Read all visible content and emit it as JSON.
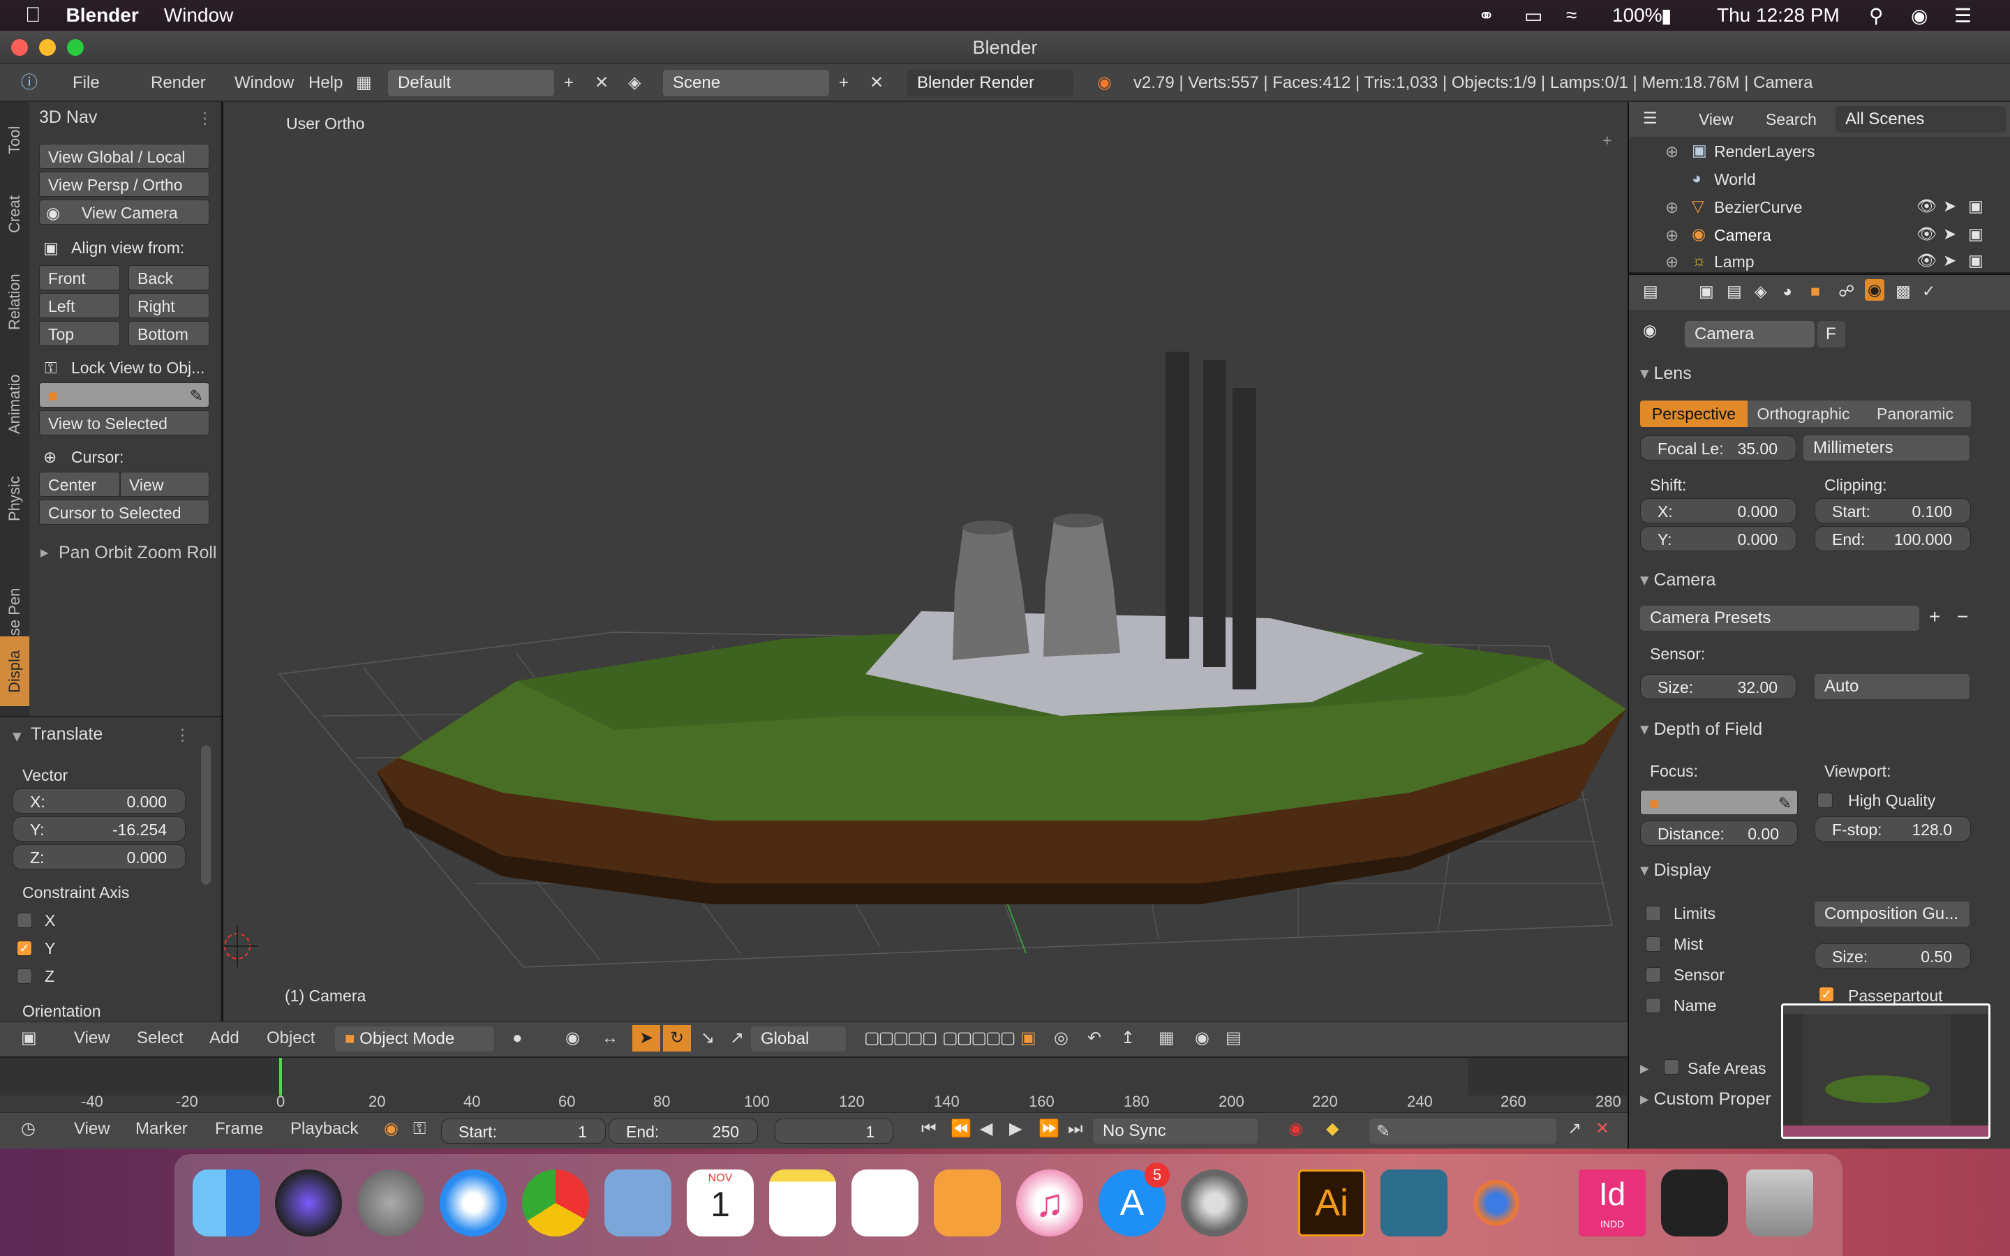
{
  "menubar": {
    "app": "Blender",
    "window_menu": "Window",
    "battery": "100%",
    "clock": "Thu 12:28 PM"
  },
  "window": {
    "title": "Blender"
  },
  "infobar": {
    "menus": [
      "File",
      "Render",
      "Window",
      "Help"
    ],
    "screen_layout": "Default",
    "scene": "Scene",
    "engine": "Blender Render",
    "stats": "v2.79 | Verts:557 | Faces:412 | Tris:1,033 | Objects:1/9 | Lamps:0/1 | Mem:18.76M | Camera"
  },
  "toolshelf": {
    "tabs": [
      "Tool",
      "Creat",
      "Relation",
      "Animatio",
      "Physic",
      "Grease Pen",
      "Displa"
    ],
    "panel_title": "3D Nav",
    "view_global_local": "View Global / Local",
    "view_persp_ortho": "View Persp / Ortho",
    "view_camera": "View Camera",
    "align_view_from": "Align view from:",
    "front": "Front",
    "back": "Back",
    "left": "Left",
    "right": "Right",
    "top": "Top",
    "bottom": "Bottom",
    "lock_view": "Lock View to Obj...",
    "view_to_selected": "View to Selected",
    "cursor_label": "Cursor:",
    "center": "Center",
    "view": "View",
    "cursor_to_selected": "Cursor to Selected",
    "pan_orbit": "Pan Orbit Zoom Roll"
  },
  "operator": {
    "title": "Translate",
    "vector_label": "Vector",
    "x_label": "X:",
    "x_value": "0.000",
    "y_label": "Y:",
    "y_value": "-16.254",
    "z_label": "Z:",
    "z_value": "0.000",
    "constraint_axis": "Constraint Axis",
    "cx": "X",
    "cy": "Y",
    "cz": "Z",
    "constraint": {
      "x": false,
      "y": true,
      "z": false
    },
    "orientation": "Orientation"
  },
  "viewport": {
    "view_name": "User Ortho",
    "object_label": "(1) Camera"
  },
  "outliner": {
    "header": {
      "view": "View",
      "search": "Search",
      "filter": "All Scenes"
    },
    "items": [
      "RenderLayers",
      "World",
      "BezierCurve",
      "Camera",
      "Lamp"
    ]
  },
  "properties": {
    "object_name": "Camera",
    "f_label": "F",
    "lens": {
      "title": "Lens",
      "tabs": [
        "Perspective",
        "Orthographic",
        "Panoramic"
      ],
      "active_tab": "Perspective",
      "focal_label": "Focal Le:",
      "focal_value": "35.00",
      "units": "Millimeters",
      "shift_label": "Shift:",
      "clipping_label": "Clipping:",
      "shift_x_label": "X:",
      "shift_x": "0.000",
      "shift_y_label": "Y:",
      "shift_y": "0.000",
      "clip_start_label": "Start:",
      "clip_start": "0.100",
      "clip_end_label": "End:",
      "clip_end": "100.000"
    },
    "camera": {
      "title": "Camera",
      "presets": "Camera Presets",
      "sensor_label": "Sensor:",
      "size_label": "Size:",
      "size_value": "32.00",
      "fit": "Auto"
    },
    "dof": {
      "title": "Depth of Field",
      "focus_label": "Focus:",
      "viewport_label": "Viewport:",
      "high_quality": "High Quality",
      "distance_label": "Distance:",
      "distance_value": "0.00",
      "fstop_label": "F-stop:",
      "fstop_value": "128.0"
    },
    "display": {
      "title": "Display",
      "limits": "Limits",
      "mist": "Mist",
      "sensor": "Sensor",
      "name": "Name",
      "composition": "Composition Gu...",
      "size_label": "Size:",
      "size_value": "0.50",
      "passepartout": "Passepartout"
    },
    "safe_areas": "Safe Areas",
    "custom_props": "Custom Proper"
  },
  "view3d_header": {
    "menus": [
      "View",
      "Select",
      "Add",
      "Object"
    ],
    "mode": "Object Mode",
    "orientation": "Global"
  },
  "timeline": {
    "ticks": [
      "-40",
      "-20",
      "0",
      "20",
      "40",
      "60",
      "80",
      "100",
      "120",
      "140",
      "160",
      "180",
      "200",
      "220",
      "240",
      "260",
      "280"
    ],
    "menus": [
      "View",
      "Marker",
      "Frame",
      "Playback"
    ],
    "start_label": "Start:",
    "start_value": "1",
    "end_label": "End:",
    "end_value": "250",
    "current": "1",
    "sync": "No Sync"
  },
  "dock": {
    "calendar_month": "NOV",
    "calendar_day": "1",
    "appstore_badge": "5",
    "illustrator": "Ai",
    "indesign": "Id",
    "indesign_sub": "INDD"
  }
}
